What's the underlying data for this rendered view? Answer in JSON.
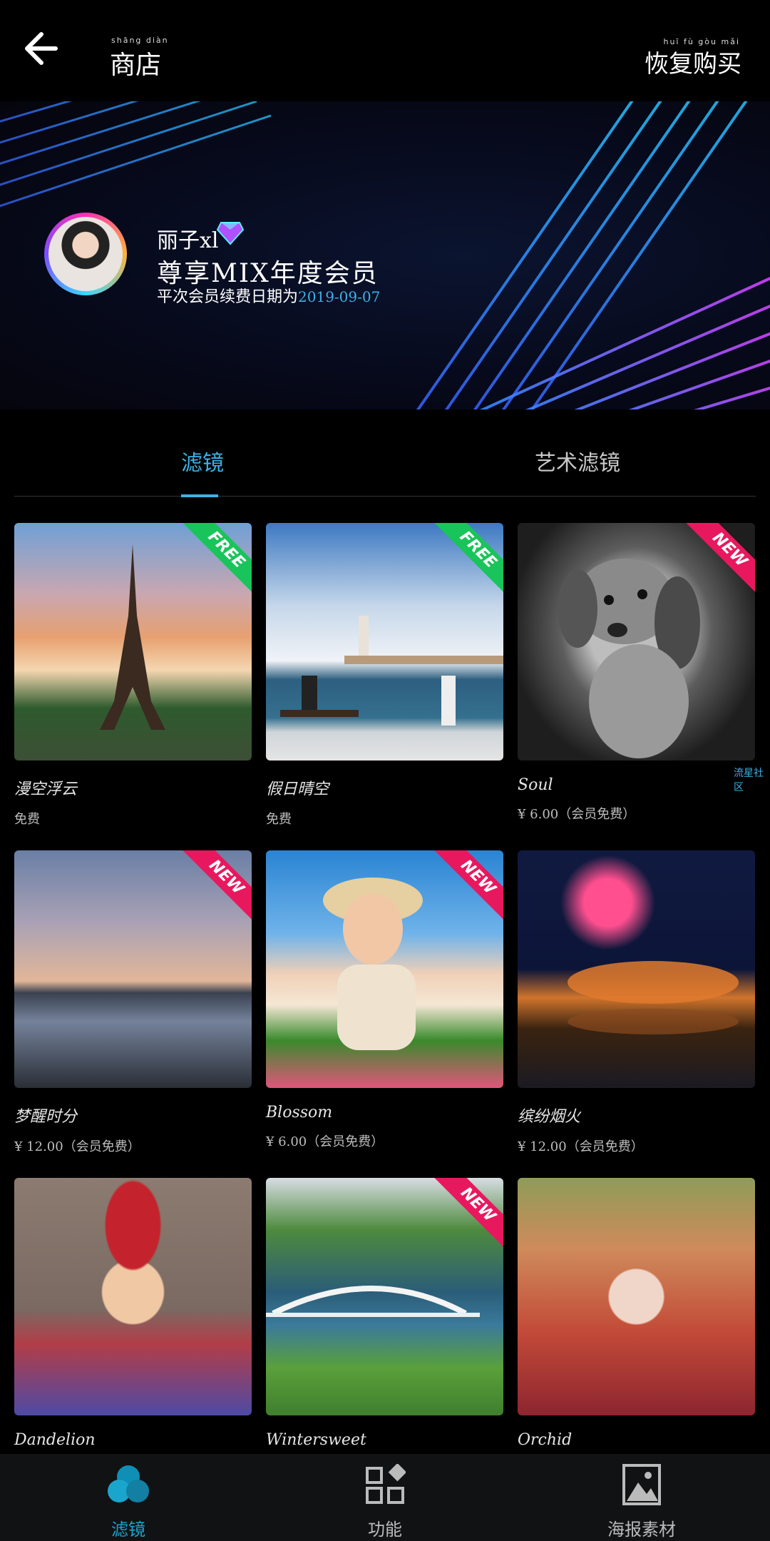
{
  "header": {
    "title": "商店",
    "title_pinyin": "shāng diàn",
    "restore": "恢复购买",
    "restore_pinyin": "huī fù gòu mǎi"
  },
  "profile": {
    "username": "丽子xl",
    "membership": "尊享MIX年度会员",
    "expiry_label": "平次会员续费日期为",
    "expiry_date": "2019-09-07"
  },
  "tabs": [
    {
      "label": "滤镜",
      "active": true
    },
    {
      "label": "艺术滤镜",
      "active": false
    }
  ],
  "items": [
    {
      "title": "漫空浮云",
      "price": "免费",
      "badge": "FREE"
    },
    {
      "title": "假日晴空",
      "price": "免费",
      "badge": "FREE"
    },
    {
      "title": "Soul",
      "price": "¥ 6.00（会员免费）",
      "badge": "NEW"
    },
    {
      "title": "梦醒时分",
      "price": "¥ 12.00（会员免费）",
      "badge": "NEW"
    },
    {
      "title": "Blossom",
      "price": "¥ 6.00（会员免费）",
      "badge": "NEW"
    },
    {
      "title": "缤纷烟火",
      "price": "¥ 12.00（会员免费）",
      "badge": ""
    },
    {
      "title": "Dandelion",
      "price": "",
      "badge": ""
    },
    {
      "title": "Wintersweet",
      "price": "",
      "badge": "NEW"
    },
    {
      "title": "Orchid",
      "price": "",
      "badge": ""
    }
  ],
  "watermark": "流星社区",
  "bottom_nav": [
    {
      "label": "滤镜",
      "icon": "filters-icon",
      "active": true
    },
    {
      "label": "功能",
      "icon": "features-icon",
      "active": false
    },
    {
      "label": "海报素材",
      "icon": "poster-icon",
      "active": false
    }
  ],
  "colors": {
    "accent": "#3bb3e6",
    "free": "#19c45a",
    "new": "#e8185f"
  }
}
